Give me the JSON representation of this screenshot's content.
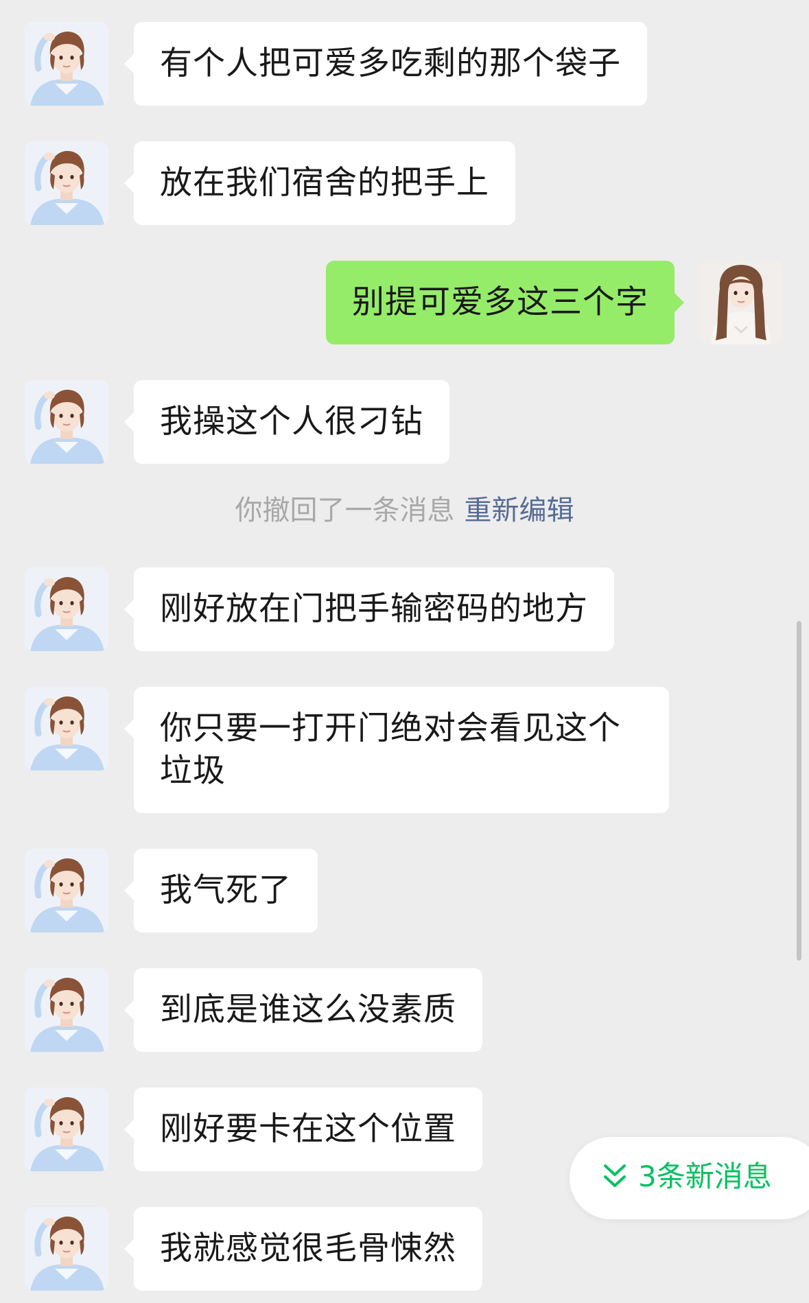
{
  "messages": [
    {
      "side": "in",
      "text": "有个人把可爱多吃剩的那个袋子"
    },
    {
      "side": "in",
      "text": "放在我们宿舍的把手上"
    },
    {
      "side": "out",
      "text": "别提可爱多这三个字"
    },
    {
      "side": "in",
      "text": "我操这个人很刁钻"
    },
    {
      "side": "in",
      "text": "刚好放在门把手输密码的地方"
    },
    {
      "side": "in",
      "text": "你只要一打开门绝对会看见这个垃圾"
    },
    {
      "side": "in",
      "text": "我气死了"
    },
    {
      "side": "in",
      "text": "到底是谁这么没素质"
    },
    {
      "side": "in",
      "text": "刚好要卡在这个位置"
    },
    {
      "side": "in",
      "text": "我就感觉很毛骨悚然"
    }
  ],
  "system_notice": {
    "text": "你撤回了一条消息",
    "action_label": "重新编辑"
  },
  "new_messages_pill": {
    "label": "3条新消息",
    "icon": "double-chevron-down-icon"
  },
  "colors": {
    "background": "#EDEDED",
    "incoming_bubble": "#FFFFFF",
    "outgoing_bubble": "#95EC69",
    "link": "#576B95",
    "accent": "#07C160"
  }
}
